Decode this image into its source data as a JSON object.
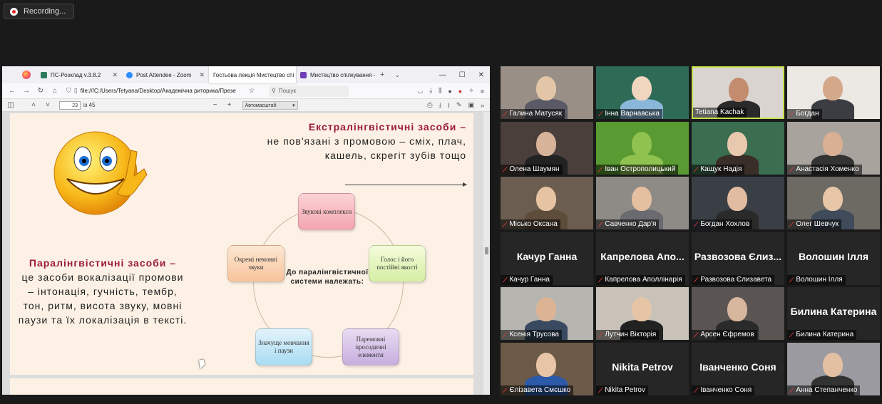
{
  "recording": {
    "label": "Recording..."
  },
  "browser": {
    "tabs": [
      {
        "label": "ПС-Розклад v.3.8.2",
        "color": "#2b7a5b"
      },
      {
        "label": "Post Attendee - Zoom",
        "color": "#2d8cff"
      },
      {
        "label": "Гостьова лекція Мистецтво спі",
        "color": "#ffffff"
      },
      {
        "label": "Мистецтво спілкування - G",
        "color": "#6f3fb5"
      }
    ],
    "url": "file:///C:/Users/Tetyana/Desktop/Академічна риторика/Презе",
    "search_placeholder": "Пошук",
    "pdf": {
      "page": "23",
      "of": "із 45",
      "zoom": "Автомасштаб"
    }
  },
  "slide": {
    "extra_title": "Екстралінгвістичні засоби",
    "extra_dash": " –",
    "extra_text": "не пов'язані з промовою – сміх, плач, кашель, скрегіт зубів тощо",
    "para_title": "Паралінгвістичні засоби –",
    "para_text": "це засоби вокалізації промови – інтонація, гучність, тембр, тон, ритм, висота звуку, мовні паузи та їх локалізація в тексті.",
    "center": "До паралінгвістичної системи належать:",
    "nodes": [
      "Звукові комплекси",
      "Голос і його постійні якості",
      "Паремовні просодичні елементи",
      "Значуще мовчання і паузи",
      "Окремі немовні звуки"
    ]
  },
  "participants": [
    {
      "name": "Галина Матусяк",
      "video": true
    },
    {
      "name": "Інна Варнавська",
      "video": true
    },
    {
      "name": "Tetiana Kachak",
      "video": true,
      "speaker": true
    },
    {
      "name": "Богдан",
      "video": true
    },
    {
      "name": "Олена Шаумян",
      "video": true
    },
    {
      "name": "Іван Острополицький",
      "video": true
    },
    {
      "name": "Кащук Надія",
      "video": true
    },
    {
      "name": "Анастасія Хоменко",
      "video": true
    },
    {
      "name": "Місько Оксана",
      "video": true
    },
    {
      "name": "Савченко Дар'я",
      "video": true
    },
    {
      "name": "Богдан Хохлов",
      "video": true
    },
    {
      "name": "Олег Шевчук",
      "video": true
    },
    {
      "name": "Качур Ганна",
      "display": "Качур Ганна",
      "video": false
    },
    {
      "name": "Капрелова Аполлінарія",
      "display": "Капрелова Апо...",
      "video": false
    },
    {
      "name": "Развозова Єлизавета",
      "display": "Развозова Єлиз...",
      "video": false
    },
    {
      "name": "Волошин Ілля",
      "display": "Волошин Ілля",
      "video": false
    },
    {
      "name": "Ксенія Трусова",
      "video": true
    },
    {
      "name": "Лутчин Вікторія",
      "video": true
    },
    {
      "name": "Арсен Єфремов",
      "video": true
    },
    {
      "name": "Билина Катерина",
      "display": "Билина Катерина",
      "video": false
    },
    {
      "name": "Єлізавета Смєшко",
      "video": true
    },
    {
      "name": "Nikita Petrov",
      "display": "Nikita Petrov",
      "video": false
    },
    {
      "name": "Іванченко Соня",
      "display": "Іванченко Соня",
      "video": false
    },
    {
      "name": "Анна Степанченко",
      "video": true
    }
  ]
}
